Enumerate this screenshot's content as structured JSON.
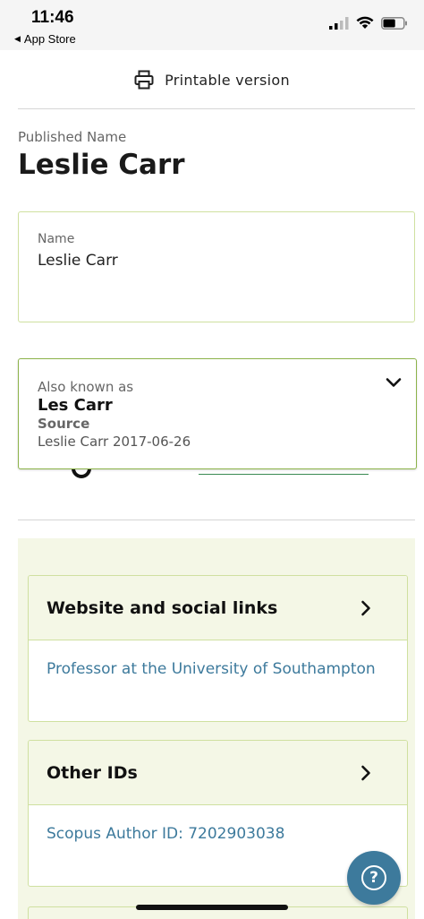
{
  "status_bar": {
    "time": "11:46",
    "back_app": "App Store",
    "back_icon": "back-triangle-icon",
    "battery_level": 0.6
  },
  "toolbar": {
    "print_icon": "printer-icon",
    "print_label": "Printable version"
  },
  "profile": {
    "published_name_label": "Published Name",
    "published_name": "Leslie Carr"
  },
  "name_card": {
    "label": "Name",
    "value": "Leslie Carr"
  },
  "aka_card": {
    "label": "Also known as",
    "name": "Les Carr",
    "source_label": "Source",
    "source_value": "Leslie Carr 2017-06-26",
    "toggle_icon": "chevron-down-icon"
  },
  "sections": [
    {
      "title": "Website and social links",
      "link": "Professor at the University of Southampton",
      "icon": "chevron-right-icon"
    },
    {
      "title": "Other IDs",
      "link": "Scopus Author ID: 7202903038",
      "icon": "chevron-right-icon"
    }
  ],
  "help": {
    "icon": "help-icon",
    "symbol": "?"
  },
  "colors": {
    "accent_link": "#3d7a9c",
    "card_border": "#cfe0a0",
    "section_bg": "#f4f7e6"
  }
}
